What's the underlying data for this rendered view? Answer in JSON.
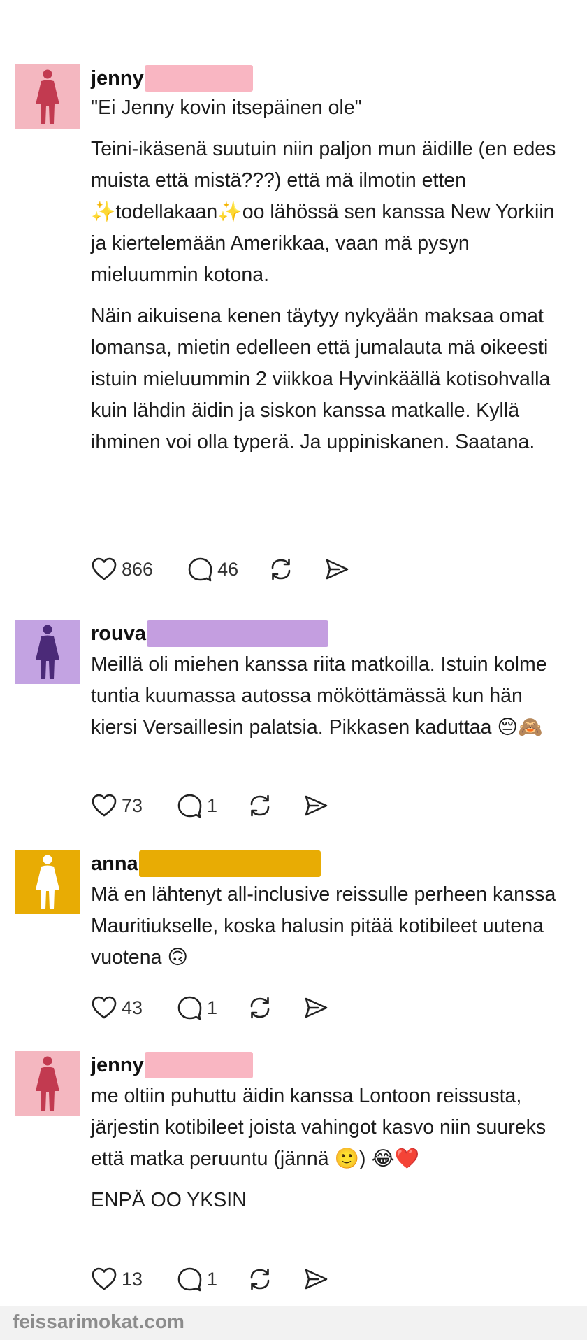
{
  "colors": {
    "jenny_avatar_bg": "#f4b7c0",
    "jenny_figure": "#c23a50",
    "jenny_redact": "#f9b6c2",
    "rouva_avatar_bg": "#c3a3e2",
    "rouva_figure": "#4b2a78",
    "rouva_redact": "#c49ee0",
    "anna_avatar_bg": "#e8ac04",
    "anna_figure": "#ffffff",
    "anna_redact": "#e8ac04"
  },
  "posts": [
    {
      "username": "jenny",
      "avatar_icon": "woman-figure-icon",
      "paragraphs": [
        "\"Ei Jenny kovin itsepäinen ole\"",
        "Teini-ikäsenä suutuin niin paljon mun äidille (en edes muista että mistä???) että mä ilmotin etten ✨todellakaan✨oo lähössä sen kanssa New Yorkiin ja kiertelemään Amerikkaa, vaan mä pysyn mieluummin kotona.",
        "Näin aikuisena kenen täytyy nykyään maksaa omat lomansa, mietin edelleen että jumalauta mä oikeesti istuin mieluummin 2 viikkoa Hyvinkäällä kotisohvalla kuin lähdin äidin ja siskon kanssa matkalle. Kyllä ihminen voi olla typerä. Ja uppiniskanen. Saatana."
      ],
      "likes": "866",
      "replies": "46"
    },
    {
      "username": "rouva",
      "avatar_icon": "woman-figure-icon",
      "paragraphs": [
        "Meillä oli miehen kanssa riita matkoilla. Istuin kolme tuntia kuumassa autossa mököttämässä kun hän kiersi Versaillesin palatsia. Pikkasen kaduttaa 😔🙈"
      ],
      "likes": "73",
      "replies": "1"
    },
    {
      "username": "anna",
      "avatar_icon": "woman-figure-icon",
      "paragraphs": [
        "Mä en lähtenyt all-inclusive reissulle perheen kanssa Mauritiukselle, koska halusin pitää kotibileet uutena vuotena 🙃"
      ],
      "likes": "43",
      "replies": "1"
    },
    {
      "username": "jenny",
      "avatar_icon": "woman-figure-icon",
      "paragraphs": [
        "me oltiin puhuttu äidin kanssa Lontoon reissusta, järjestin kotibileet joista vahingot kasvo niin suureks että matka peruuntu (jännä 🙂) 😂❤️",
        "ENPÄ OO YKSIN"
      ],
      "likes": "13",
      "replies": "1"
    }
  ],
  "footer": {
    "watermark": "feissarimokat.com"
  }
}
